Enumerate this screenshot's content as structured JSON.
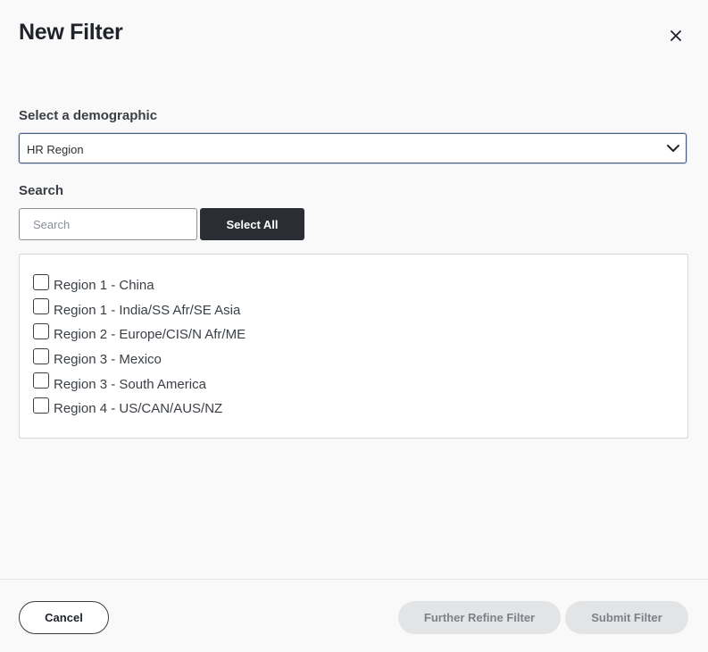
{
  "dialog": {
    "title": "New Filter",
    "close_icon": "close-icon"
  },
  "demographic": {
    "label": "Select a demographic",
    "selected_value": "HR Region",
    "chevron_icon": "chevron-down-icon"
  },
  "search": {
    "label": "Search",
    "placeholder": "Search",
    "value": "",
    "select_all_label": "Select All"
  },
  "options": [
    {
      "label": "Region 1 - China",
      "checked": false
    },
    {
      "label": "Region 1 - India/SS Afr/SE Asia",
      "checked": false
    },
    {
      "label": "Region 2 - Europe/CIS/N Afr/ME",
      "checked": false
    },
    {
      "label": "Region 3 - Mexico",
      "checked": false
    },
    {
      "label": "Region 3 - South America",
      "checked": false
    },
    {
      "label": "Region 4 - US/CAN/AUS/NZ",
      "checked": false
    }
  ],
  "footer": {
    "cancel_label": "Cancel",
    "refine_label": "Further Refine Filter",
    "submit_label": "Submit Filter"
  },
  "colors": {
    "primary_button": "#2a2d33",
    "disabled_button": "#e3e4e6",
    "focus_border": "#4a5d7e"
  }
}
